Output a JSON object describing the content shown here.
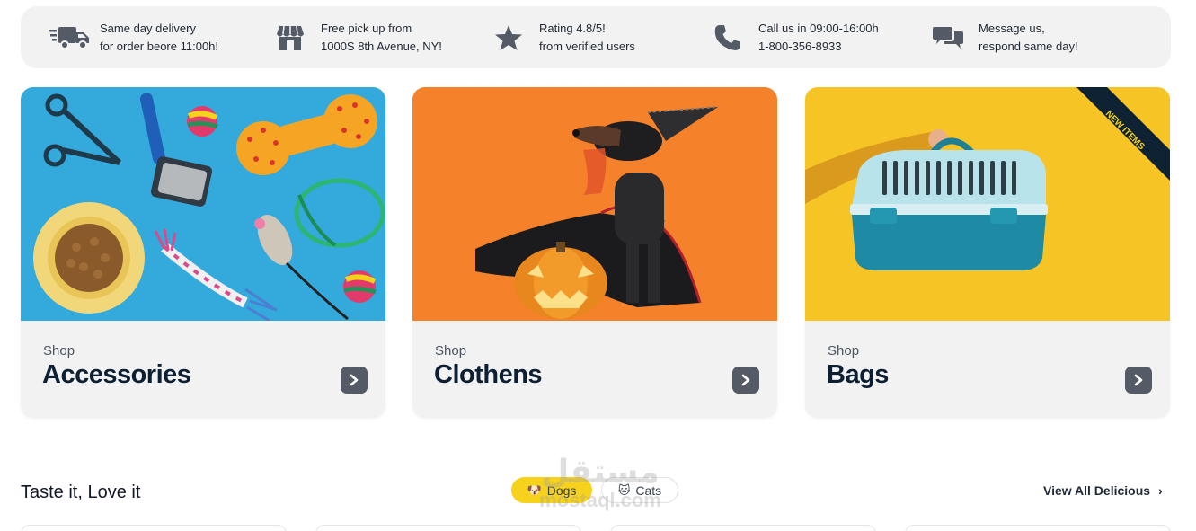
{
  "features": [
    {
      "icon": "delivery-truck-icon",
      "line1": "Same day delivery",
      "line2": "for order beore 11:00h!"
    },
    {
      "icon": "store-icon",
      "line1": "Free pick up from",
      "line2": "1000S 8th Avenue, NY!"
    },
    {
      "icon": "star-icon",
      "line1": "Rating 4.8/5!",
      "line2": "from verified users"
    },
    {
      "icon": "phone-icon",
      "line1": "Call us in 09:00-16:00h",
      "line2": "1-800-356-8933"
    },
    {
      "icon": "chat-bubbles-icon",
      "line1": "Message us,",
      "line2": "respond same day!"
    }
  ],
  "categories": [
    {
      "shop": "Shop",
      "title": "Accessories",
      "image": "pet accessories photo"
    },
    {
      "shop": "Shop",
      "title": "Clothens",
      "image": "dog costume photo"
    },
    {
      "shop": "Shop",
      "title": "Bags",
      "image": "pet carrier photo",
      "ribbon": "NEW ITEMS"
    }
  ],
  "section": {
    "title": "Taste it, Love it",
    "tabs": [
      {
        "label": "Dogs",
        "icon": "dog-icon",
        "active": true
      },
      {
        "label": "Cats",
        "icon": "cat-icon",
        "active": false
      }
    ],
    "view_all": "View All Delicious"
  },
  "watermark": {
    "arabic": "مستقل",
    "latin": "mostaql.com"
  },
  "colors": {
    "accent_yellow": "#f6d21c",
    "dark_navy": "#0c1f33",
    "panel_grey": "#f2f2f2",
    "arrow_button": "#545b66",
    "icon_grey": "#545b66"
  }
}
